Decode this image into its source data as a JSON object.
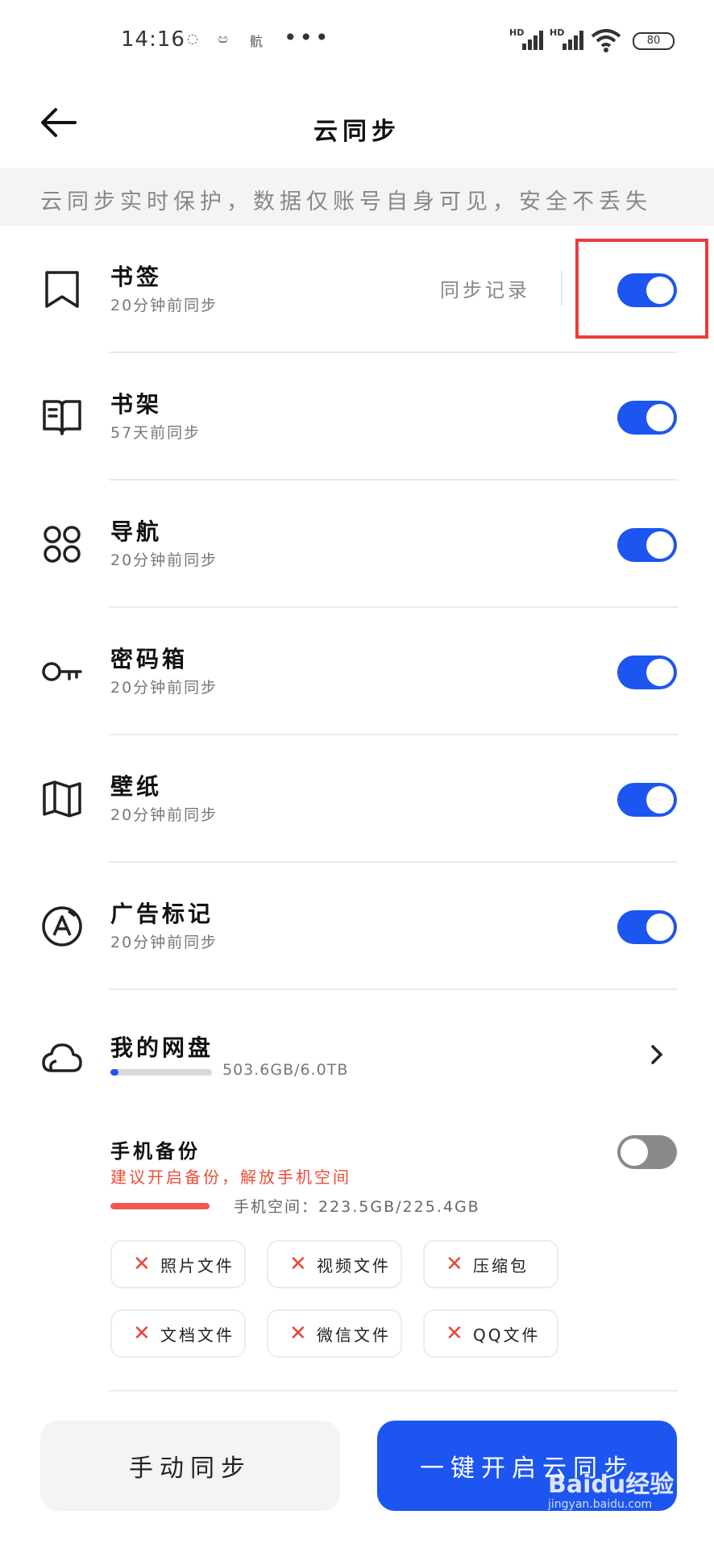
{
  "status_bar": {
    "time": "14:16",
    "notif1": "◌",
    "notif2": "ඏ",
    "notif3": "骯",
    "more": "•••",
    "network_labels": [
      "HD",
      "HD"
    ],
    "battery": "80"
  },
  "header": {
    "title": "云同步"
  },
  "banner": {
    "text": "云同步实时保护，数据仅账号自身可见，安全不丢失"
  },
  "sync_items": [
    {
      "name": "书签",
      "sub": "20分钟前同步",
      "icon": "bookmark-icon",
      "enabled": true,
      "sync_log": "同步记录"
    },
    {
      "name": "书架",
      "sub": "57天前同步",
      "icon": "bookshelf-icon",
      "enabled": true
    },
    {
      "name": "导航",
      "sub": "20分钟前同步",
      "icon": "grid-icon",
      "enabled": true
    },
    {
      "name": "密码箱",
      "sub": "20分钟前同步",
      "icon": "key-icon",
      "enabled": true
    },
    {
      "name": "壁纸",
      "sub": "20分钟前同步",
      "icon": "wallpaper-icon",
      "enabled": true
    },
    {
      "name": "广告标记",
      "sub": "20分钟前同步",
      "icon": "ad-block-icon",
      "enabled": true
    }
  ],
  "cloud_drive": {
    "name": "我的网盘",
    "usage": "503.6GB/6.0TB",
    "usage_fraction": 0.08,
    "icon": "cloud-icon"
  },
  "phone_backup": {
    "name": "手机备份",
    "warning": "建议开启备份，解放手机空间",
    "space": "手机空间：223.5GB/225.4GB",
    "space_fraction": 0.99,
    "enabled": false,
    "options": [
      "照片文件",
      "视频文件",
      "压缩包",
      "文档文件",
      "微信文件",
      "QQ文件"
    ]
  },
  "buttons": {
    "manual": "手动同步",
    "primary": "一键开启云同步"
  },
  "watermark": {
    "text": "Baidu经验",
    "sub": "jingyan.baidu.com"
  },
  "colors": {
    "accent": "#1c55f0",
    "warning": "#ec4d3a",
    "highlight": "#ec3b3b"
  }
}
